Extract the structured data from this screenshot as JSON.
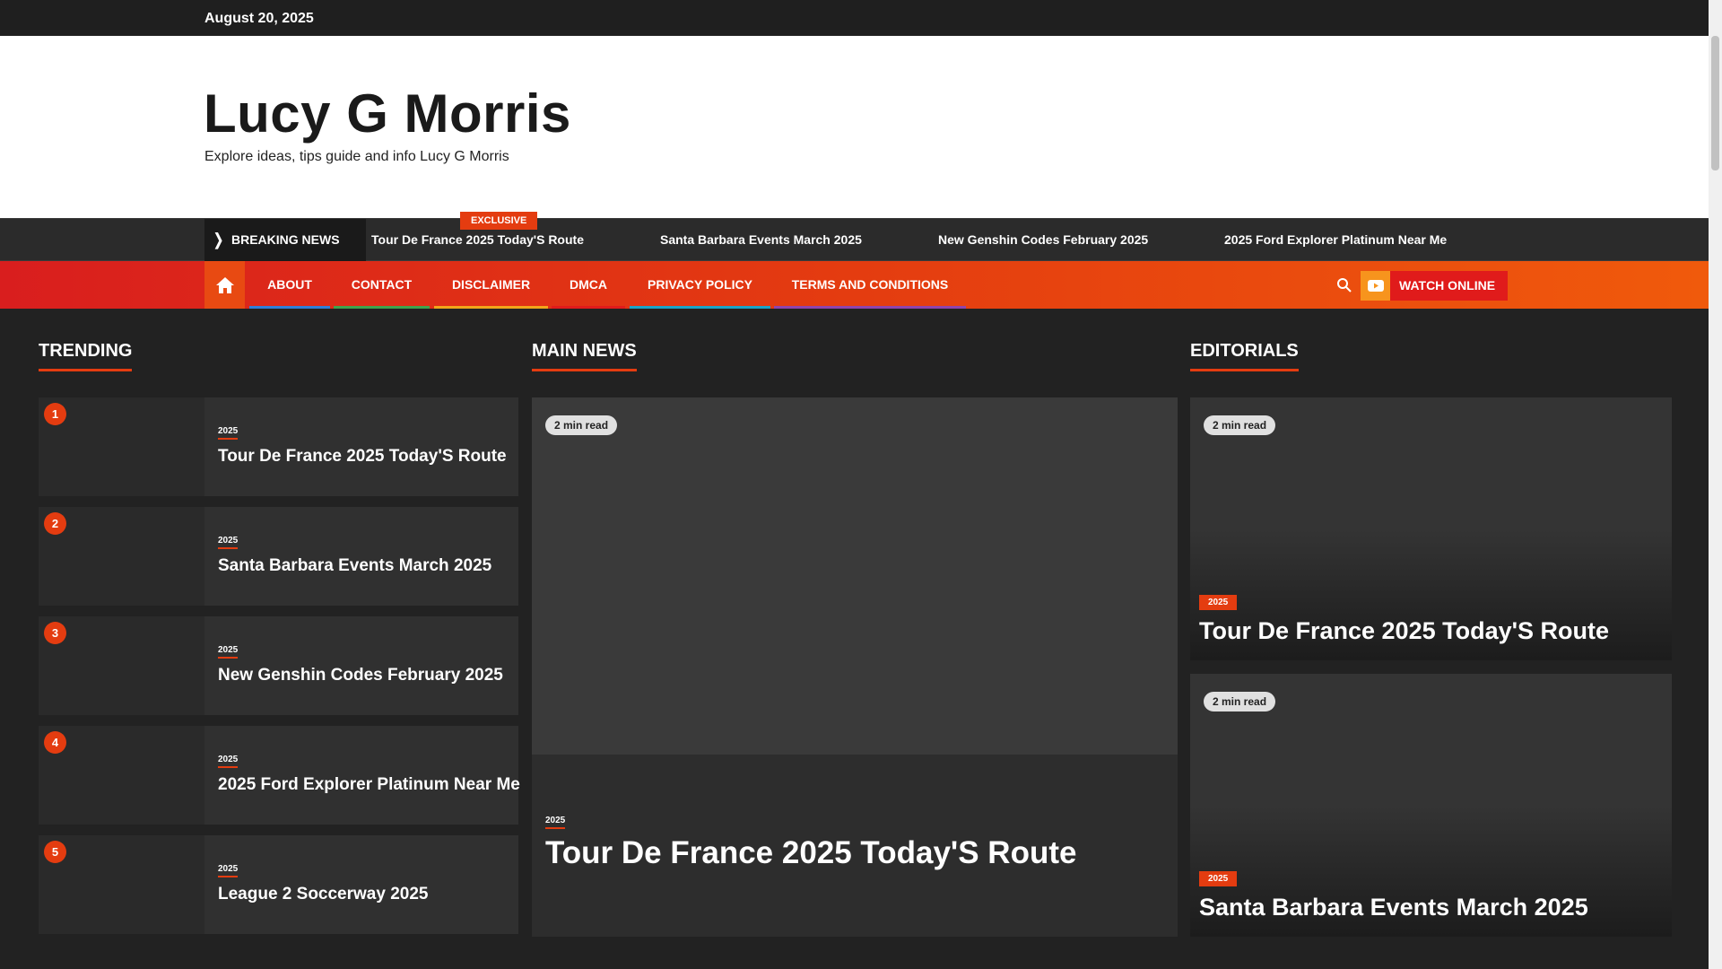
{
  "topbar": {
    "date": "August 20, 2025"
  },
  "site": {
    "title": "Lucy G Morris",
    "tagline": "Explore ideas, tips guide and info Lucy G Morris"
  },
  "breaking": {
    "badge": "EXCLUSIVE",
    "label": "BREAKING NEWS",
    "items": [
      "Tour De France 2025 Today'S Route",
      "Santa Barbara Events March 2025",
      "New Genshin Codes February 2025",
      "2025 Ford Explorer Platinum Near Me"
    ]
  },
  "nav": {
    "items": [
      "ABOUT",
      "CONTACT",
      "DISCLAIMER",
      "DMCA",
      "PRIVACY POLICY",
      "TERMS AND CONDITIONS"
    ],
    "underline_colors": [
      "#2f7ed8",
      "#3fa34d",
      "#f2a51a",
      "#e01b1b",
      "#1aa3c8",
      "#8e44ad"
    ],
    "watch_label": "WATCH ONLINE"
  },
  "trending": {
    "title": "TRENDING",
    "items": [
      {
        "num": "1",
        "cat": "2025",
        "title": "Tour De France 2025 Today'S Route"
      },
      {
        "num": "2",
        "cat": "2025",
        "title": "Santa Barbara Events March 2025"
      },
      {
        "num": "3",
        "cat": "2025",
        "title": "New Genshin Codes February 2025"
      },
      {
        "num": "4",
        "cat": "2025",
        "title": "2025 Ford Explorer Platinum Near Me"
      },
      {
        "num": "5",
        "cat": "2025",
        "title": "League 2 Soccerway 2025"
      }
    ]
  },
  "main_news": {
    "title": "MAIN NEWS",
    "read_time": "2 min read",
    "cat": "2025",
    "headline": "Tour De France 2025 Today'S Route"
  },
  "editorials": {
    "title": "EDITORIALS",
    "items": [
      {
        "read_time": "2 min read",
        "cat": "2025",
        "title": "Tour De France 2025 Today'S Route"
      },
      {
        "read_time": "2 min read",
        "cat": "2025",
        "title": "Santa Barbara Events March 2025"
      }
    ]
  },
  "colors": {
    "accent": "#e43c10",
    "nav_start": "#d91e1e",
    "nav_end": "#f05a0c"
  }
}
